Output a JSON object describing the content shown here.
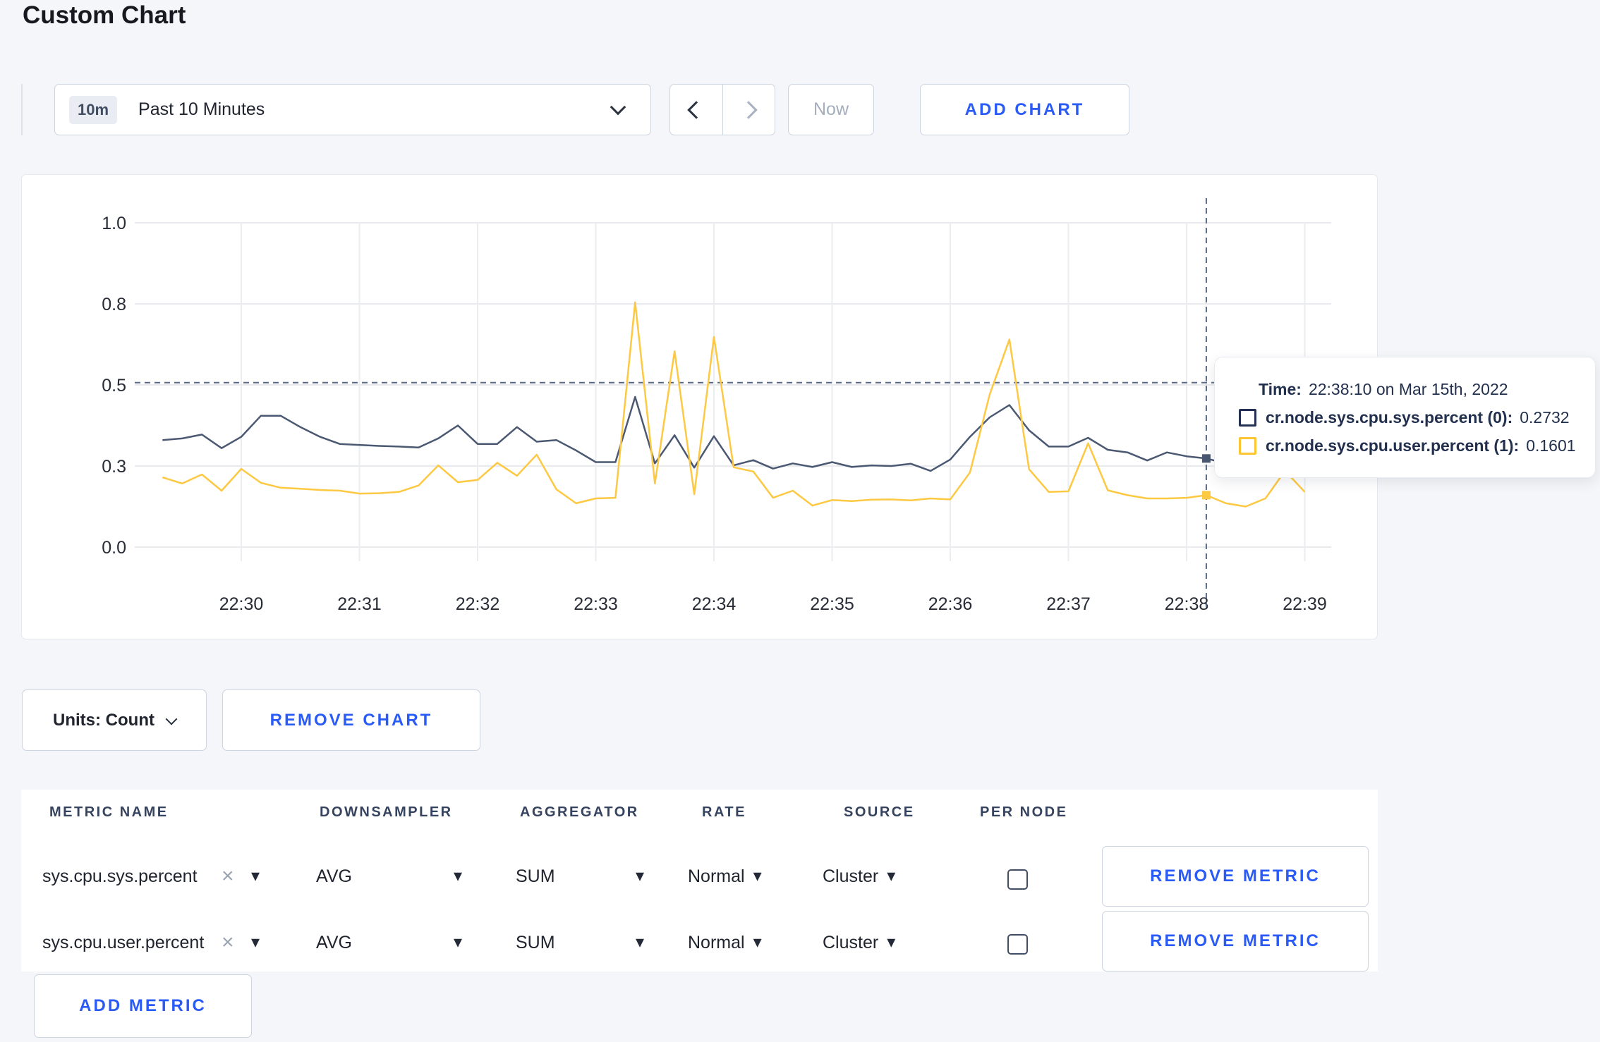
{
  "page": {
    "title": "Custom Chart"
  },
  "toolbar": {
    "time_range": {
      "badge": "10m",
      "label": "Past 10 Minutes"
    },
    "now_label": "Now",
    "add_chart_label": "ADD CHART"
  },
  "icons": {
    "caret_down": "▾",
    "remove_x": "×"
  },
  "chart_data": {
    "type": "line",
    "title": "",
    "x_ticks": [
      "22:30",
      "22:31",
      "22:32",
      "22:33",
      "22:34",
      "22:35",
      "22:36",
      "22:37",
      "22:38",
      "22:39"
    ],
    "y_ticks": [
      {
        "label": "1.0",
        "value": 1.0
      },
      {
        "label": "0.8",
        "value": 0.75
      },
      {
        "label": "0.5",
        "value": 0.5
      },
      {
        "label": "0.3",
        "value": 0.25
      },
      {
        "label": "0.0",
        "value": 0.0
      }
    ],
    "ylim": [
      0,
      1
    ],
    "grid": true,
    "x_start": "22:29:20",
    "x_interval_s": 10,
    "series": [
      {
        "name": "cr.node.sys.cpu.sys.percent",
        "color": "#4a5872",
        "points": [
          [
            0,
            0.33
          ],
          [
            10,
            0.335
          ],
          [
            20,
            0.347
          ],
          [
            30,
            0.305
          ],
          [
            40,
            0.34
          ],
          [
            50,
            0.405
          ],
          [
            60,
            0.405
          ],
          [
            70,
            0.37
          ],
          [
            80,
            0.34
          ],
          [
            90,
            0.318
          ],
          [
            100,
            0.315
          ],
          [
            110,
            0.312
          ],
          [
            120,
            0.31
          ],
          [
            130,
            0.307
          ],
          [
            140,
            0.335
          ],
          [
            150,
            0.375
          ],
          [
            160,
            0.318
          ],
          [
            170,
            0.318
          ],
          [
            180,
            0.37
          ],
          [
            190,
            0.325
          ],
          [
            200,
            0.33
          ],
          [
            210,
            0.298
          ],
          [
            220,
            0.262
          ],
          [
            230,
            0.262
          ],
          [
            240,
            0.463
          ],
          [
            250,
            0.258
          ],
          [
            260,
            0.345
          ],
          [
            270,
            0.245
          ],
          [
            280,
            0.342
          ],
          [
            290,
            0.252
          ],
          [
            300,
            0.268
          ],
          [
            310,
            0.242
          ],
          [
            320,
            0.258
          ],
          [
            330,
            0.247
          ],
          [
            340,
            0.262
          ],
          [
            350,
            0.247
          ],
          [
            360,
            0.252
          ],
          [
            370,
            0.25
          ],
          [
            380,
            0.257
          ],
          [
            390,
            0.235
          ],
          [
            400,
            0.27
          ],
          [
            410,
            0.34
          ],
          [
            420,
            0.4
          ],
          [
            430,
            0.438
          ],
          [
            440,
            0.36
          ],
          [
            450,
            0.31
          ],
          [
            460,
            0.31
          ],
          [
            470,
            0.337
          ],
          [
            480,
            0.3
          ],
          [
            490,
            0.292
          ],
          [
            500,
            0.267
          ],
          [
            510,
            0.292
          ],
          [
            520,
            0.28
          ],
          [
            530,
            0.2732
          ],
          [
            540,
            0.258
          ],
          [
            550,
            0.296
          ],
          [
            560,
            0.302
          ],
          [
            570,
            0.295
          ],
          [
            580,
            0.288
          ]
        ]
      },
      {
        "name": "cr.node.sys.cpu.user.percent",
        "color": "#fdc842",
        "points": [
          [
            0,
            0.215
          ],
          [
            10,
            0.196
          ],
          [
            20,
            0.224
          ],
          [
            30,
            0.174
          ],
          [
            40,
            0.241
          ],
          [
            50,
            0.198
          ],
          [
            60,
            0.183
          ],
          [
            70,
            0.18
          ],
          [
            80,
            0.176
          ],
          [
            90,
            0.174
          ],
          [
            100,
            0.165
          ],
          [
            110,
            0.166
          ],
          [
            120,
            0.17
          ],
          [
            130,
            0.19
          ],
          [
            140,
            0.252
          ],
          [
            150,
            0.2
          ],
          [
            160,
            0.207
          ],
          [
            170,
            0.26
          ],
          [
            180,
            0.22
          ],
          [
            190,
            0.285
          ],
          [
            200,
            0.178
          ],
          [
            210,
            0.135
          ],
          [
            220,
            0.15
          ],
          [
            230,
            0.152
          ],
          [
            240,
            0.755
          ],
          [
            250,
            0.196
          ],
          [
            260,
            0.604
          ],
          [
            270,
            0.163
          ],
          [
            280,
            0.648
          ],
          [
            290,
            0.246
          ],
          [
            300,
            0.233
          ],
          [
            310,
            0.152
          ],
          [
            320,
            0.174
          ],
          [
            330,
            0.128
          ],
          [
            340,
            0.145
          ],
          [
            350,
            0.142
          ],
          [
            360,
            0.146
          ],
          [
            370,
            0.147
          ],
          [
            380,
            0.144
          ],
          [
            390,
            0.15
          ],
          [
            400,
            0.147
          ],
          [
            410,
            0.23
          ],
          [
            420,
            0.47
          ],
          [
            430,
            0.64
          ],
          [
            440,
            0.24
          ],
          [
            450,
            0.17
          ],
          [
            460,
            0.172
          ],
          [
            470,
            0.32
          ],
          [
            480,
            0.175
          ],
          [
            490,
            0.16
          ],
          [
            500,
            0.15
          ],
          [
            510,
            0.15
          ],
          [
            520,
            0.152
          ],
          [
            530,
            0.1601
          ],
          [
            540,
            0.135
          ],
          [
            550,
            0.125
          ],
          [
            560,
            0.15
          ],
          [
            570,
            0.235
          ],
          [
            580,
            0.17
          ]
        ]
      }
    ],
    "crosshair": {
      "offset_s": 530,
      "hline_value": 0.507,
      "marker_values": [
        0.2732,
        0.1601
      ]
    }
  },
  "tooltip": {
    "time_label": "Time:",
    "time_value": "22:38:10 on Mar 15th, 2022",
    "series": [
      {
        "label": "cr.node.sys.cpu.sys.percent (0):",
        "value": "0.2732",
        "swatch": "#243154"
      },
      {
        "label": "cr.node.sys.cpu.user.percent (1):",
        "value": "0.1601",
        "swatch": "#fdc530"
      }
    ]
  },
  "chart_footer": {
    "units_label": "Units: Count",
    "remove_chart_label": "REMOVE CHART"
  },
  "metrics_table": {
    "headers": [
      "METRIC NAME",
      "DOWNSAMPLER",
      "AGGREGATOR",
      "RATE",
      "SOURCE",
      "PER NODE"
    ],
    "rows": [
      {
        "metric": "sys.cpu.sys.percent",
        "downsampler": "AVG",
        "aggregator": "SUM",
        "rate": "Normal",
        "source": "Cluster",
        "per_node_checked": false,
        "remove_label": "REMOVE METRIC"
      },
      {
        "metric": "sys.cpu.user.percent",
        "downsampler": "AVG",
        "aggregator": "SUM",
        "rate": "Normal",
        "source": "Cluster",
        "per_node_checked": false,
        "remove_label": "REMOVE METRIC"
      }
    ],
    "add_metric_label": "ADD METRIC"
  },
  "colors": {
    "accent_blue": "#2a5bf7",
    "line_sys": "#4a5872",
    "line_user": "#fdc842",
    "page_bg": "#f4f6f9"
  }
}
